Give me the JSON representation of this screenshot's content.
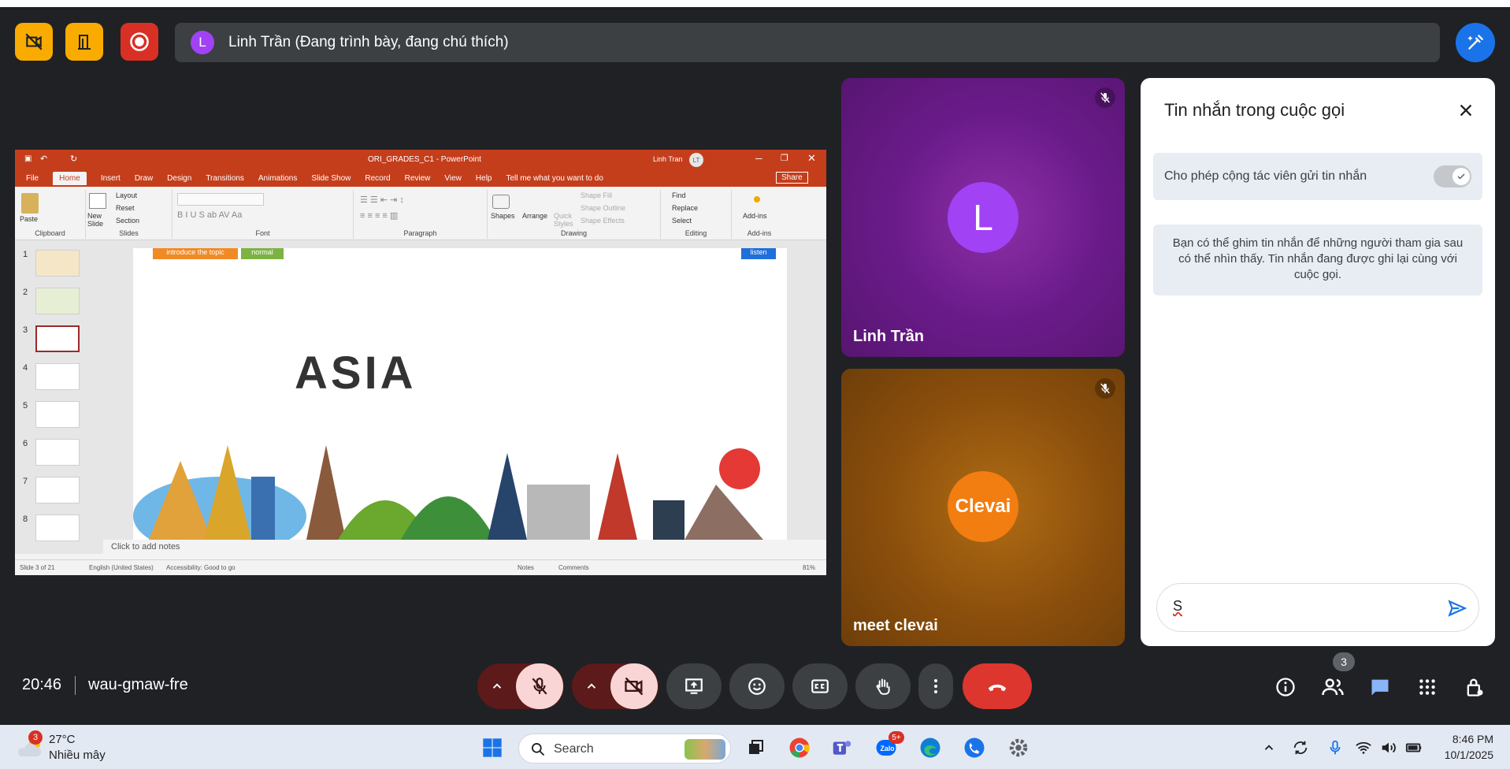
{
  "banner": {
    "avatar_letter": "L",
    "text": "Linh Trần (Đang trình bày, đang chú thích)"
  },
  "powerpoint": {
    "title": "ORI_GRADES_C1 - PowerPoint",
    "user": "Linh Tran",
    "user_initials": "LT",
    "tabs": [
      "File",
      "Home",
      "Insert",
      "Draw",
      "Design",
      "Transitions",
      "Animations",
      "Slide Show",
      "Record",
      "Review",
      "View",
      "Help"
    ],
    "tell_me": "Tell me what you want to do",
    "share": "Share",
    "groups": [
      "Clipboard",
      "Slides",
      "Font",
      "Paragraph",
      "Drawing",
      "Editing",
      "Add-ins"
    ],
    "ribbon_buttons": {
      "paste": "Paste",
      "new_slide": "New Slide",
      "layout": "Layout",
      "reset": "Reset",
      "section": "Section",
      "shapes": "Shapes",
      "arrange": "Arrange",
      "quick_styles": "Quick Styles",
      "shape_fill": "Shape Fill",
      "shape_outline": "Shape Outline",
      "shape_effects": "Shape Effects",
      "find": "Find",
      "replace": "Replace",
      "select": "Select",
      "addins": "Add-ins"
    },
    "thumb_numbers": [
      "1",
      "2",
      "3",
      "4",
      "5",
      "6",
      "7",
      "8"
    ],
    "slide_tags": [
      "introduce the topic",
      "normal",
      "listen"
    ],
    "slide_title": "ASIA",
    "notes_placeholder": "Click to add notes",
    "status": {
      "slide": "Slide 3 of 21",
      "language": "English (United States)",
      "accessibility": "Accessibility: Good to go",
      "notes": "Notes",
      "comments": "Comments",
      "zoom": "81%"
    }
  },
  "tiles": [
    {
      "name": "Linh Trần",
      "avatar": "L"
    },
    {
      "name": "meet clevai",
      "avatar": "Clevai"
    }
  ],
  "chat": {
    "title": "Tin nhắn trong cuộc gọi",
    "setting_label": "Cho phép cộng tác viên gửi tin nhắn",
    "info": "Bạn có thể ghim tin nhắn để những người tham gia sau có thể nhìn thấy. Tin nhắn đang được ghi lại cùng với cuộc gọi.",
    "input_value": "S",
    "toggle_on": true
  },
  "bottom": {
    "time": "20:46",
    "meeting_code": "wau-gmaw-fre",
    "people_count": "3"
  },
  "taskbar": {
    "weather_badge": "3",
    "temperature": "27°C",
    "weather_desc": "Nhiều mây",
    "search": "Search",
    "zalo_badge": "5+",
    "time": "8:46 PM",
    "date": "10/1/2025"
  },
  "colors": {
    "meet_bg": "#202124",
    "accent_blue": "#1a73e8",
    "end_call": "#dc362e",
    "ppt_orange": "#c43e1c"
  }
}
